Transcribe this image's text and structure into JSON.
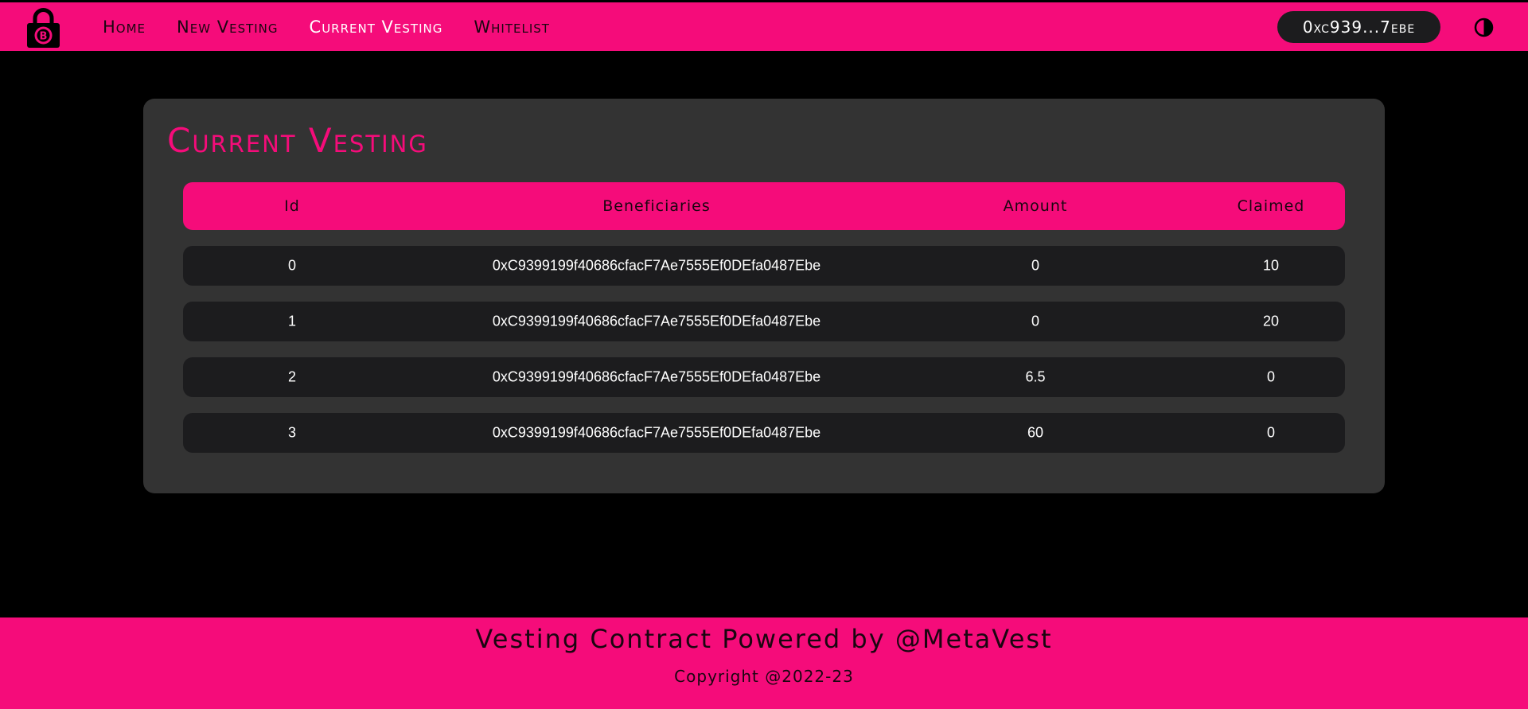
{
  "nav": {
    "logo_icon": "bitcoin-lock-icon",
    "links": [
      {
        "label": "Home"
      },
      {
        "label": "New Vesting"
      },
      {
        "label": "Current Vesting",
        "active": true
      },
      {
        "label": "Whitelist"
      }
    ],
    "wallet_label": "0xc939...7ebe",
    "theme_icon": "half-circle-contrast-icon"
  },
  "main": {
    "title": "Current Vesting",
    "columns": [
      "Id",
      "Beneficiaries",
      "Amount",
      "Claimed"
    ],
    "rows": [
      {
        "id": "0",
        "beneficiary": "0xC9399199f40686cfacF7Ae7555Ef0DEfa0487Ebe",
        "amount": "0",
        "claimed": "10"
      },
      {
        "id": "1",
        "beneficiary": "0xC9399199f40686cfacF7Ae7555Ef0DEfa0487Ebe",
        "amount": "0",
        "claimed": "20"
      },
      {
        "id": "2",
        "beneficiary": "0xC9399199f40686cfacF7Ae7555Ef0DEfa0487Ebe",
        "amount": "6.5",
        "claimed": "0"
      },
      {
        "id": "3",
        "beneficiary": "0xC9399199f40686cfacF7Ae7555Ef0DEfa0487Ebe",
        "amount": "60",
        "claimed": "0"
      }
    ]
  },
  "footer": {
    "title": "Vesting Contract Powered by @MetaVest",
    "copyright": "Copyright @2022-23"
  },
  "colors": {
    "accent": "#f50c7a",
    "background": "#000000",
    "card": "#333333",
    "row": "#1c1c1e"
  }
}
